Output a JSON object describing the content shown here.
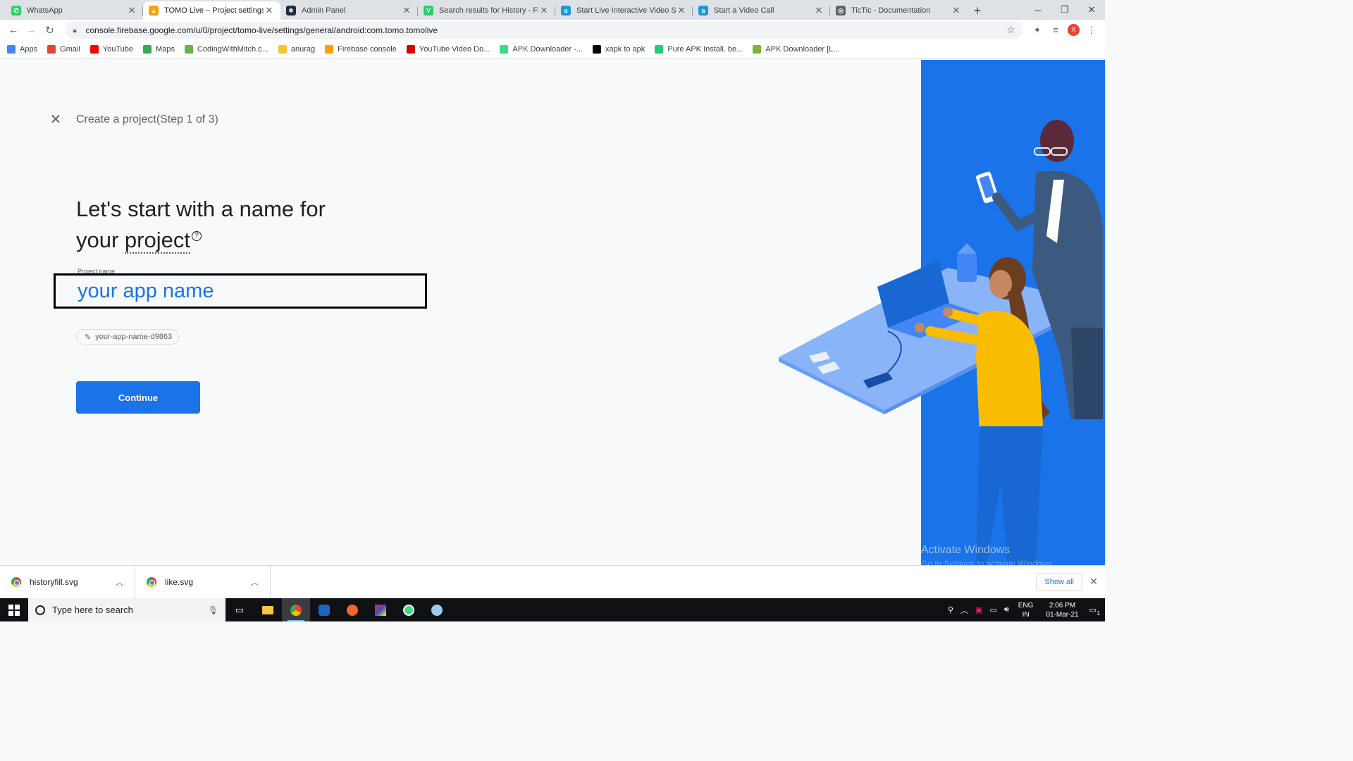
{
  "browser": {
    "tabs": [
      {
        "title": "WhatsApp",
        "color": "#25d366",
        "glyph": "✆"
      },
      {
        "title": "TOMO Live – Project settings – Fi",
        "color": "#ffa000",
        "glyph": "▲"
      },
      {
        "title": "Admin Panel",
        "color": "#1e2a3a",
        "glyph": "⚛"
      },
      {
        "title": "Search results for History - Flatic",
        "color": "#2ecc71",
        "glyph": "V"
      },
      {
        "title": "Start Live Interactive Video Strear",
        "color": "#1a9bd7",
        "glyph": "a"
      },
      {
        "title": "Start a Video Call",
        "color": "#1a9bd7",
        "glyph": "a"
      },
      {
        "title": "TicTic - Documentation",
        "color": "#5f6368",
        "glyph": "◎"
      }
    ],
    "url": "console.firebase.google.com/u/0/project/tomo-live/settings/general/android:com.tomo.tomolive",
    "profile_initial": "X",
    "bookmarks": [
      {
        "label": "Apps",
        "color": "#4285f4"
      },
      {
        "label": "Gmail",
        "color": "#ea4335"
      },
      {
        "label": "YouTube",
        "color": "#ff0000"
      },
      {
        "label": "Maps",
        "color": "#34a853"
      },
      {
        "label": "CodingWithMitch.c...",
        "color": "#6ab04c"
      },
      {
        "label": "anurag",
        "color": "#f4c430"
      },
      {
        "label": "Firebase console",
        "color": "#ffa000"
      },
      {
        "label": "YouTube Video Do...",
        "color": "#d50000"
      },
      {
        "label": "APK Downloader -...",
        "color": "#3ddc84"
      },
      {
        "label": "xapk to apk",
        "color": "#000000"
      },
      {
        "label": "Pure APK Install, be...",
        "color": "#24cd77"
      },
      {
        "label": "APK Downloader [L...",
        "color": "#7cb342"
      }
    ]
  },
  "page": {
    "step_title": "Create a project(Step 1 of 3)",
    "headline_line1": "Let's start with a name for",
    "headline_line2_prefix": "your ",
    "headline_underlined": "project",
    "help_glyph": "?",
    "project_name_label": "Project name",
    "project_name_value": "your app name",
    "project_id": "your-app-name-d9863",
    "continue_label": "Continue",
    "watermark_title": "Activate Windows",
    "watermark_sub": "Go to Settings to activate Windows."
  },
  "downloads": {
    "items": [
      {
        "name": "historyfill.svg"
      },
      {
        "name": "like.svg"
      }
    ],
    "show_all": "Show all"
  },
  "taskbar": {
    "search_placeholder": "Type here to search",
    "lang_top": "ENG",
    "lang_bottom": "IN",
    "time": "2:06 PM",
    "date": "01-Mar-21",
    "notification_count": "1"
  },
  "colors": {
    "accent": "#1a73e8",
    "illustration_bg": "#1a73e8"
  }
}
